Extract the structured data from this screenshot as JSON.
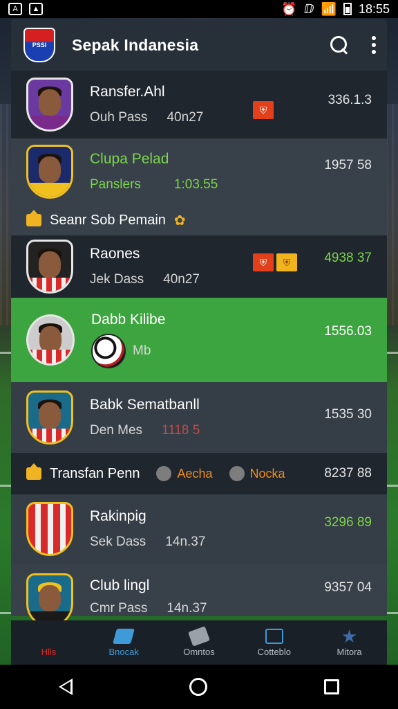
{
  "status_bar": {
    "time": "18:55",
    "notif_1": "A",
    "notif_2": "▲",
    "signal_text": "ⅅ"
  },
  "app": {
    "title": "Sepak Indanesia",
    "logo_text": "PSSI",
    "search_icon": "search-icon",
    "menu_icon": "more-vert-icon"
  },
  "rows": [
    {
      "name": "Ransfer.Ahl",
      "sub_left": "Ouh Pass",
      "sub_right": "40n27",
      "value": "336.1.3",
      "value_color": "#e4e4e4",
      "badges": [
        "red"
      ]
    },
    {
      "name": "Clupa Pelad",
      "sub_left": "Panslers",
      "sub_right": "1:03.55",
      "value": "1957 58",
      "name_color": "#7bd64a"
    },
    {
      "name": "Raones",
      "sub_left": "Jek Dass",
      "sub_right": "40n27",
      "value": "4938 37",
      "badges": [
        "red",
        "yellow"
      ]
    },
    {
      "name": "Dabb Kilibe",
      "sub_left": "Mb",
      "value": "1556.03"
    },
    {
      "name": "Babk Sematbanll",
      "sub_left": "Den Mes",
      "sub_right": "1118 5",
      "value": "1535 30"
    },
    {
      "name": "Rakinpig",
      "sub_left": "Sek Dass",
      "sub_right": "14n.37",
      "value": "3296 89"
    },
    {
      "name": "Club lingl",
      "sub_left": "Cmr Pass",
      "sub_right": "14n.37",
      "value": "9357 04"
    }
  ],
  "section_1": {
    "label": "Seanr Sob Pemain"
  },
  "section_2": {
    "label": "Transfan Penn",
    "pill_1": "Aecha",
    "pill_2": "Nocka",
    "value": "8237 88"
  },
  "bottom_nav": {
    "items": [
      {
        "label": "Hlls",
        "icon": "home-icon"
      },
      {
        "label": "Bnocak",
        "icon": "transfer-icon"
      },
      {
        "label": "Omntos",
        "icon": "tag-icon"
      },
      {
        "label": "Cotteblo",
        "icon": "match-icon"
      },
      {
        "label": "Mitora",
        "icon": "star-icon"
      }
    ]
  },
  "colors": {
    "accent_green": "#3da53f",
    "value_green": "#7bd64a",
    "badge_red": "#e2401a",
    "badge_yellow": "#f2b41c",
    "nav_active": "#3f9ad8"
  }
}
